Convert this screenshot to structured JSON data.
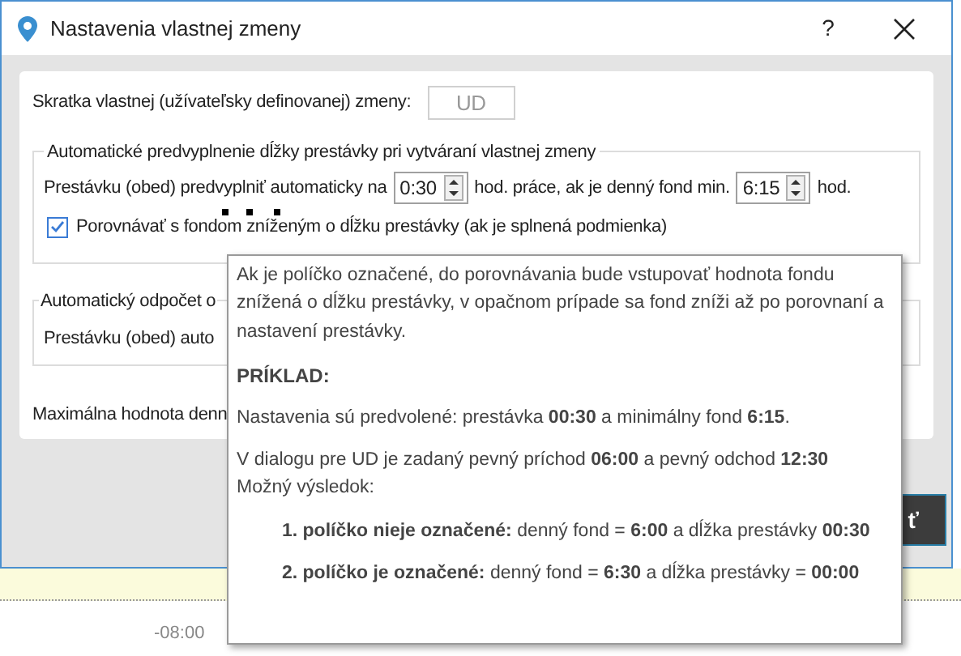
{
  "window": {
    "title": "Nastavenia vlastnej zmeny",
    "help": "?"
  },
  "shortcut": {
    "label": "Skratka vlastnej (užívateľsky definovanej) zmeny:",
    "value": "UD",
    "disabled": true
  },
  "group_1": {
    "legend": "Automatické predvyplnenie dĺžky prestávky pri vytváraní vlastnej zmeny",
    "row": {
      "label": "Prestávku (obed) predvyplniť automaticky na",
      "break_value": "0:30",
      "middle": "hod. práce, ak je denný fond min.",
      "fund_value": "6:15",
      "unit": "hod."
    },
    "checkbox": {
      "label": "Porovnávať s fondom zníženým o dĺžku prestávky (ak je splnená podmienka)",
      "checked": true
    }
  },
  "group_2": {
    "legend": "Automatický odpočet o",
    "row": "Prestávku (obed) auto"
  },
  "max_label": "Maximálna hodnota denn",
  "button": "ť",
  "calendar": {
    "time": "-08:00"
  },
  "tooltip": {
    "paragraphs": [
      {
        "kind": "text",
        "text": "Ak je políčko označené, do porovnávania bude vstupovať hodnota fondu znížená o dĺžku prestávky, v opačnom prípade sa fond zníži až po porovnaní a nastavení prestávky."
      },
      {
        "kind": "heading",
        "text": "PRÍKLAD:"
      },
      {
        "kind": "text",
        "text": "Nastavenia sú predvolené: prestávka **00:30** a minimálny fond **6:15**."
      },
      {
        "kind": "text",
        "text": "V dialogu pre UD je zadaný pevný príchod **06:00** a pevný odchod **12:30**\nMožný výsledok:"
      },
      {
        "kind": "item",
        "text": "**1. políčko nieje označené:** denný fond = **6:00** a dĺžka prestávky **00:30**"
      },
      {
        "kind": "item",
        "text": "**2. políčko je označené:** denný fond = **6:30** a dĺžka prestávky = **00:00**"
      }
    ]
  }
}
